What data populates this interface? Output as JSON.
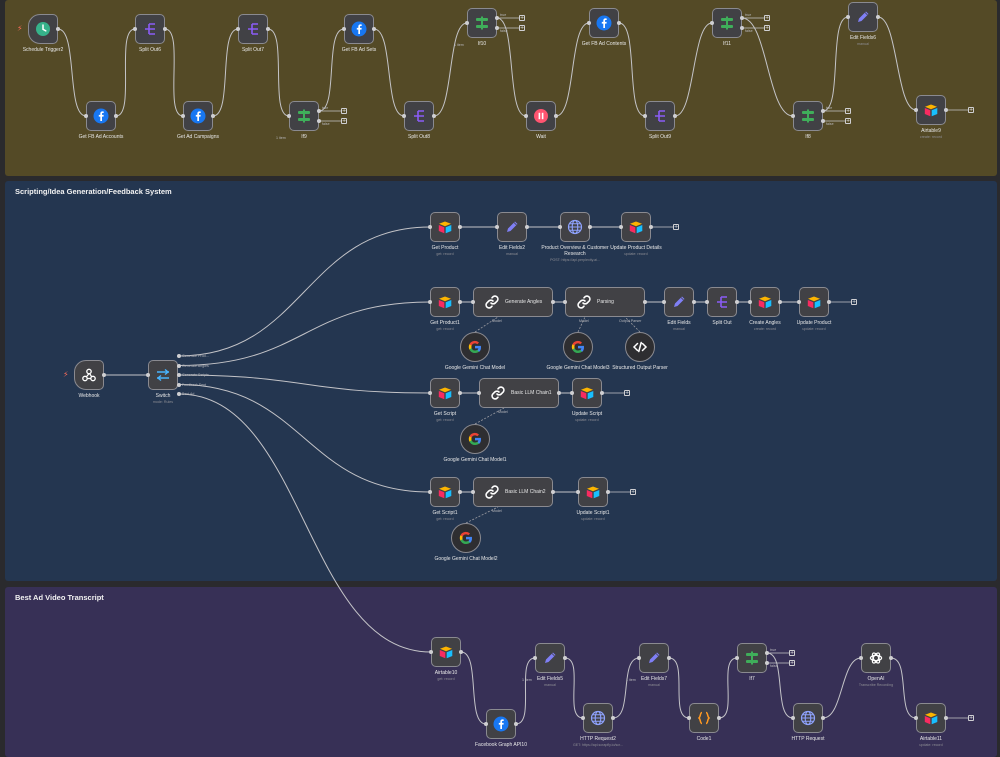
{
  "stickies": [
    {
      "title": "",
      "color": "#544a26"
    },
    {
      "title": "Scripting/Idea Generation/Feedback System",
      "color": "#243650"
    },
    {
      "title": "Best Ad Video Transcript",
      "color": "#373056"
    }
  ],
  "nodes": [
    {
      "id": "n1",
      "name": "Schedule Trigger2",
      "sub": "",
      "icon": "clock",
      "trigger": true
    },
    {
      "id": "n2",
      "name": "Get FB Ad Accounts",
      "sub": "",
      "icon": "facebook"
    },
    {
      "id": "n3",
      "name": "Split Out6",
      "sub": "",
      "icon": "split"
    },
    {
      "id": "n4",
      "name": "Get Ad Campaigns",
      "sub": "",
      "icon": "facebook"
    },
    {
      "id": "n5",
      "name": "Split Out7",
      "sub": "",
      "icon": "split"
    },
    {
      "id": "n6",
      "name": "If9",
      "sub": "",
      "icon": "if"
    },
    {
      "id": "n7",
      "name": "Get FB Ad Sets",
      "sub": "",
      "icon": "facebook"
    },
    {
      "id": "n8",
      "name": "Split Out8",
      "sub": "",
      "icon": "split"
    },
    {
      "id": "n9",
      "name": "If10",
      "sub": "",
      "icon": "if"
    },
    {
      "id": "n10",
      "name": "Wait",
      "sub": "",
      "icon": "wait"
    },
    {
      "id": "n11",
      "name": "Get FB Ad Contents",
      "sub": "",
      "icon": "facebook"
    },
    {
      "id": "n12",
      "name": "Split Out9",
      "sub": "",
      "icon": "split"
    },
    {
      "id": "n13",
      "name": "If11",
      "sub": "",
      "icon": "if"
    },
    {
      "id": "n14",
      "name": "If8",
      "sub": "",
      "icon": "if"
    },
    {
      "id": "n15",
      "name": "Edit Fields6",
      "sub": "manual",
      "icon": "pen"
    },
    {
      "id": "n16",
      "name": "Airtable9",
      "sub": "create: record",
      "icon": "airtable"
    },
    {
      "id": "w1",
      "name": "Webhook",
      "sub": "",
      "icon": "webhook",
      "trigger": true
    },
    {
      "id": "w2",
      "name": "Switch",
      "sub": "mode: Rules",
      "icon": "switch"
    },
    {
      "id": "p1",
      "name": "Get Product",
      "sub": "get: record",
      "icon": "airtable"
    },
    {
      "id": "p2",
      "name": "Edit Fields2",
      "sub": "manual",
      "icon": "pen"
    },
    {
      "id": "p3",
      "name": "Product Overview & Customer Research",
      "sub": "POST: https://api.perplexity.ai...",
      "icon": "globe"
    },
    {
      "id": "p4",
      "name": "Update Product Details",
      "sub": "update: record",
      "icon": "airtable"
    },
    {
      "id": "g1",
      "name": "Get Product1",
      "sub": "get: record",
      "icon": "airtable"
    },
    {
      "id": "g2",
      "name": "Generate Angles",
      "sub": "",
      "icon": "chain",
      "wide": true
    },
    {
      "id": "g3",
      "name": "Parsing",
      "sub": "",
      "icon": "chain",
      "wide": true
    },
    {
      "id": "g4",
      "name": "Edit Fields",
      "sub": "manual",
      "icon": "pen"
    },
    {
      "id": "g5",
      "name": "Split Out",
      "sub": "",
      "icon": "split"
    },
    {
      "id": "g6",
      "name": "Create Angles",
      "sub": "create: record",
      "icon": "airtable"
    },
    {
      "id": "g7",
      "name": "Update Product",
      "sub": "update: record",
      "icon": "airtable"
    },
    {
      "id": "g8",
      "name": "Google Gemini Chat Model",
      "sub": "",
      "icon": "google",
      "round": true
    },
    {
      "id": "g9",
      "name": "Google Gemini Chat Model3",
      "sub": "",
      "icon": "google",
      "round": true
    },
    {
      "id": "g10",
      "name": "Structured Output Parser",
      "sub": "",
      "icon": "code",
      "round": true
    },
    {
      "id": "s1",
      "name": "Get Script",
      "sub": "get: record",
      "icon": "airtable"
    },
    {
      "id": "s2",
      "name": "Basic LLM Chain1",
      "sub": "",
      "icon": "chain",
      "wide": true
    },
    {
      "id": "s3",
      "name": "Update Script",
      "sub": "update: record",
      "icon": "airtable"
    },
    {
      "id": "s4",
      "name": "Google Gemini Chat Model1",
      "sub": "",
      "icon": "google",
      "round": true
    },
    {
      "id": "f1",
      "name": "Get Script1",
      "sub": "get: record",
      "icon": "airtable"
    },
    {
      "id": "f2",
      "name": "Basic LLM Chain2",
      "sub": "",
      "icon": "chain",
      "wide": true
    },
    {
      "id": "f3",
      "name": "Update Script1",
      "sub": "update: record",
      "icon": "airtable"
    },
    {
      "id": "f4",
      "name": "Google Gemini Chat Model2",
      "sub": "",
      "icon": "google",
      "round": true
    },
    {
      "id": "b1",
      "name": "Airtable10",
      "sub": "get: record",
      "icon": "airtable"
    },
    {
      "id": "b2",
      "name": "Facebook Graph API10",
      "sub": "",
      "icon": "facebook"
    },
    {
      "id": "b3",
      "name": "Edit Fields5",
      "sub": "manual",
      "icon": "pen"
    },
    {
      "id": "b4",
      "name": "HTTP Request2",
      "sub": "GET: https://api.scrapfly.io/scr...",
      "icon": "globe"
    },
    {
      "id": "b5",
      "name": "Edit Fields7",
      "sub": "manual",
      "icon": "pen"
    },
    {
      "id": "b6",
      "name": "Code1",
      "sub": "",
      "icon": "braces"
    },
    {
      "id": "b7",
      "name": "If7",
      "sub": "",
      "icon": "if"
    },
    {
      "id": "b8",
      "name": "HTTP Request",
      "sub": "",
      "icon": "globe"
    },
    {
      "id": "b9",
      "name": "OpenAI",
      "sub": "Transcribe Recording",
      "icon": "openai"
    },
    {
      "id": "b10",
      "name": "Airtable11",
      "sub": "update: record",
      "icon": "airtable"
    }
  ],
  "port_labels": {
    "if_true": "true",
    "if_false": "false",
    "switch_outputs": [
      "Generate Prod...",
      "Generate Angles",
      "Generate Scripts",
      "Feedback Sent",
      "Best Ad"
    ],
    "model": "Model",
    "output_parser": "Output Parser",
    "loop_label": "1 item"
  },
  "colors": {
    "facebook": "#1877f2",
    "if": "#3fae5a",
    "split": "#8a5cf6",
    "pen": "#7f7ff5",
    "wait": "#ff5470",
    "clock": "#36b28a",
    "airtable_yellow": "#fcb400",
    "airtable_red": "#f82b60",
    "airtable_blue": "#18bfff",
    "orange_code": "#ff9922",
    "wire": "#c4c4c8"
  }
}
